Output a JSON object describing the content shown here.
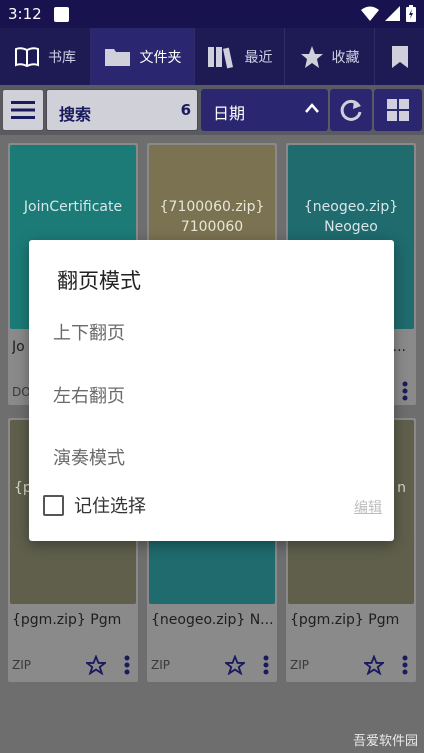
{
  "status_bar": {
    "time": "3:12"
  },
  "tabs": [
    {
      "label": "书库",
      "icon": "book-icon"
    },
    {
      "label": "文件夹",
      "icon": "folder-icon"
    },
    {
      "label": "最近",
      "icon": "books-icon"
    },
    {
      "label": "收藏",
      "icon": "star-icon"
    },
    {
      "label": "",
      "icon": "bookmark-icon"
    }
  ],
  "toolbar": {
    "search_label": "搜索",
    "search_count": "6",
    "sort_label": "日期"
  },
  "books": [
    {
      "cover_text": "JoinCertificate",
      "title": "Jo",
      "format": "DO",
      "cover_color": "#1c7b77"
    },
    {
      "cover_text": "{7100060.zip}\n7100060",
      "title": "",
      "format": "",
      "cover_color": "#7a7250"
    },
    {
      "cover_text": "{neogeo.zip}\nNeogeo",
      "title": "...",
      "format": "",
      "cover_color": "#1f6b6e"
    },
    {
      "cover_text": "{p",
      "title": "{pgm.zip} Pgm",
      "format": "ZIP",
      "cover_color": "#5f5f4c"
    },
    {
      "cover_text": "",
      "title": "{neogeo.zip} N...",
      "format": "ZIP",
      "cover_color": "#1f6b6e"
    },
    {
      "cover_text": "n",
      "title": "{pgm.zip} Pgm",
      "format": "ZIP",
      "cover_color": "#5f5f4c"
    }
  ],
  "dialog": {
    "title": "翻页模式",
    "options": [
      "上下翻页",
      "左右翻页",
      "演奏模式"
    ],
    "remember_label": "记住选择",
    "edit_label": "编辑"
  },
  "watermark": "吾爱软件园"
}
